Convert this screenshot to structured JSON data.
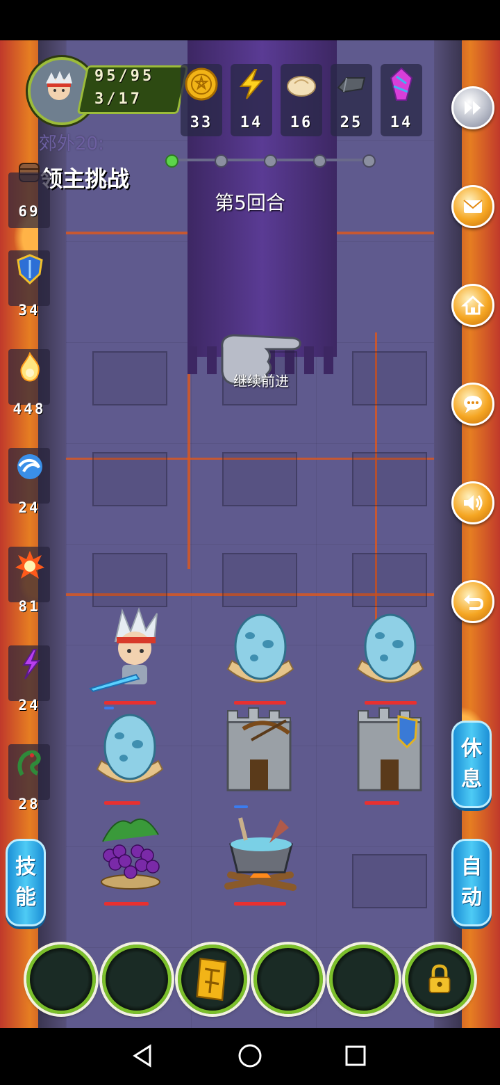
{
  "hero": {
    "hp": "95/95",
    "stage_progress": "3/17",
    "zone": "郊外20:"
  },
  "resources": [
    {
      "icon": "gold-coin-icon",
      "value": "33"
    },
    {
      "icon": "lightning-icon",
      "value": "14"
    },
    {
      "icon": "bun-food-icon",
      "value": "16"
    },
    {
      "icon": "iron-ingot-icon",
      "value": "25"
    },
    {
      "icon": "purple-crystal-icon",
      "value": "14"
    }
  ],
  "stats": [
    {
      "icon": "fist-attack-icon",
      "value": "69"
    },
    {
      "icon": "shield-defense-icon",
      "value": "34"
    },
    {
      "icon": "flame-spirit-icon",
      "value": "448"
    },
    {
      "icon": "water-swirl-icon",
      "value": "24"
    },
    {
      "icon": "fire-burst-icon",
      "value": "81"
    },
    {
      "icon": "purple-lightning-icon",
      "value": "24"
    },
    {
      "icon": "green-serpent-icon",
      "value": "28"
    }
  ],
  "challenge": {
    "label": "领主挑战"
  },
  "round": {
    "label": "第5回合",
    "dots": 5,
    "active": 1
  },
  "hint": {
    "text": "继续前进"
  },
  "side_buttons": {
    "rest": "休息",
    "skill": "技能",
    "auto": "自动"
  },
  "board": {
    "units": [
      {
        "name": "hero-unit",
        "hp": 1.0
      },
      {
        "name": "egg-unit",
        "hp": 1.0
      },
      {
        "name": "egg-unit",
        "hp": 1.0
      },
      {
        "name": "egg-unit",
        "hp": 1.0
      },
      {
        "name": "crossbow-tower-unit",
        "hp": 0.0
      },
      {
        "name": "shield-tower-unit",
        "hp": 1.0
      },
      {
        "name": "grape-bush-unit",
        "hp": 1.0
      },
      {
        "name": "cooking-pot-unit",
        "hp": 1.0
      }
    ]
  },
  "bottom_slots": [
    {
      "item": "empty"
    },
    {
      "item": "empty"
    },
    {
      "item": "gold-bar-icon"
    },
    {
      "item": "empty"
    },
    {
      "item": "empty"
    },
    {
      "item": "lock-icon"
    }
  ],
  "colors": {
    "accent": "#f5a623",
    "hp_bar": "#e83030",
    "slot_ring": "#7bbf2b",
    "pill": "#2aa6e6"
  }
}
